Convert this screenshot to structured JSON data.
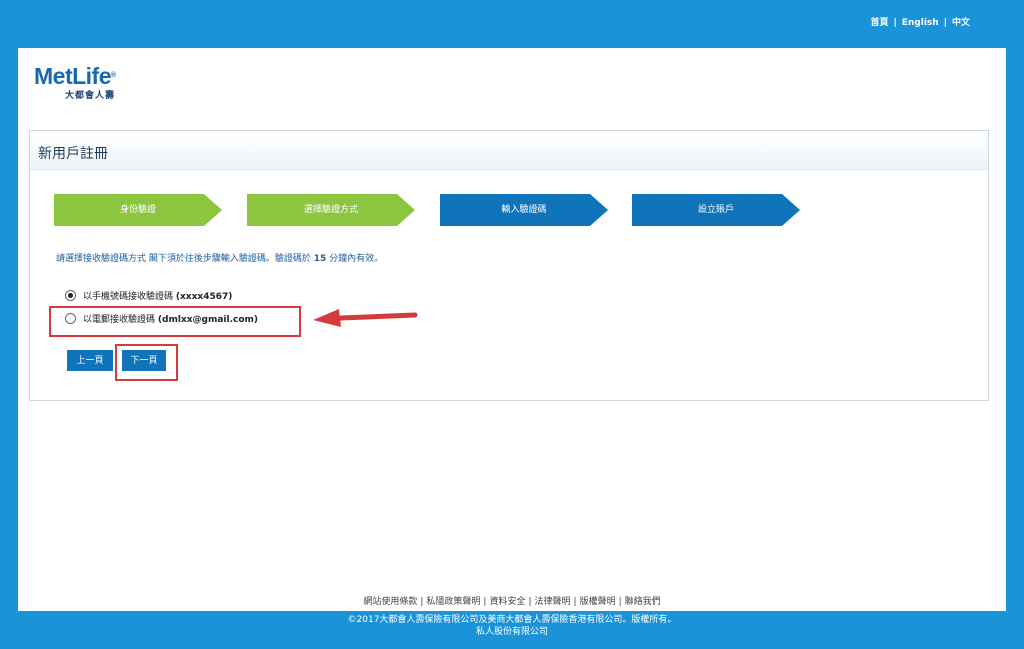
{
  "top_nav": {
    "home": "首頁",
    "english": "English",
    "chinese": "中文",
    "separator": "|"
  },
  "logo": {
    "brand": "MetLife",
    "registered": "®",
    "chinese_name": "大都會人壽"
  },
  "panel": {
    "title": "新用戶註冊"
  },
  "steps": [
    {
      "label": "身份驗證",
      "status": "done"
    },
    {
      "label": "選擇驗證方式",
      "status": "done"
    },
    {
      "label": "輸入驗證碼",
      "status": "pending"
    },
    {
      "label": "設立賬戶",
      "status": "pending"
    }
  ],
  "instruction": {
    "text_before": "請選擇接收驗證碼方式 閣下須於往後步驟輸入驗證碼。驗證碼於 ",
    "minutes": "15",
    "text_after": " 分鐘內有效。"
  },
  "options": [
    {
      "label": "以手機號碼接收驗證碼",
      "value": "(xxxx4567)",
      "checked": true
    },
    {
      "label": "以電郵接收驗證碼",
      "value": "(dmlxx@gmail.com)",
      "checked": false
    }
  ],
  "buttons": {
    "prev": "上一頁",
    "next": "下一頁"
  },
  "footer": {
    "links": [
      "網站使用條款",
      "私隱政策聲明",
      "資料安全",
      "法律聲明",
      "版權聲明",
      "聯絡我們"
    ],
    "separator": "|",
    "copyright_line1": "©2017大都會人壽保險有限公司及美商大都會人壽保險香港有限公司。版權所有。",
    "copyright_line2": "私人股份有限公司"
  },
  "colors": {
    "background": "#1b93d8",
    "step_done": "#8cc63f",
    "step_pending": "#0f74b9",
    "highlight": "#d63b3b",
    "brand": "#1868b3"
  }
}
